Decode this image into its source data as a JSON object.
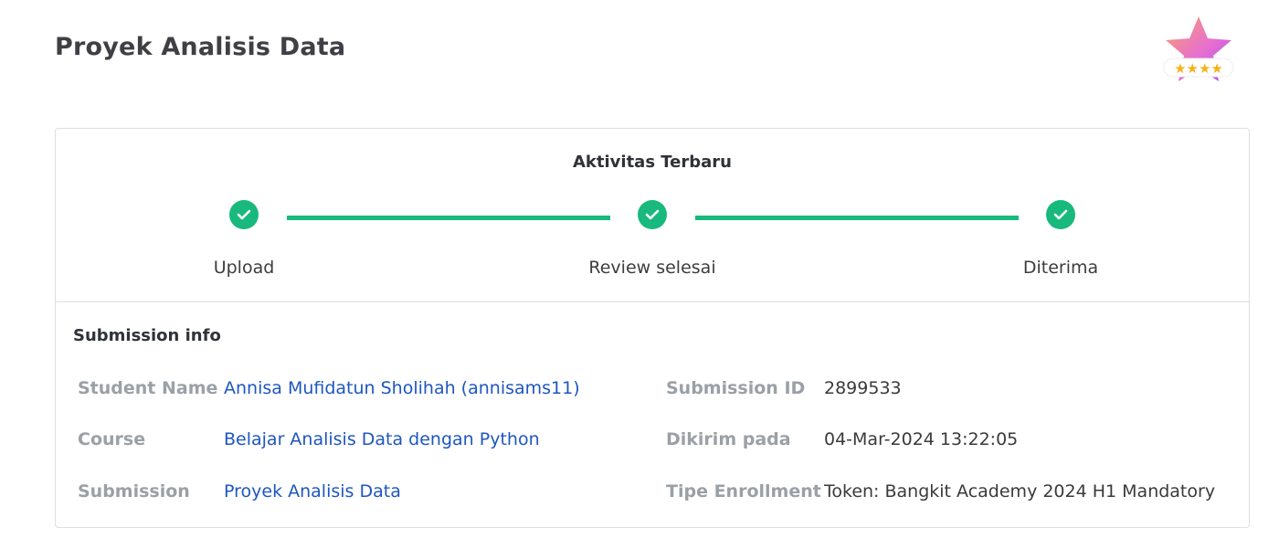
{
  "header": {
    "title": "Proyek Analisis Data",
    "badge": {
      "icon": "star-rating-badge-icon",
      "stars": 4
    }
  },
  "activity": {
    "title": "Aktivitas Terbaru",
    "steps": [
      {
        "label": "Upload",
        "status": "done"
      },
      {
        "label": "Review selesai",
        "status": "done"
      },
      {
        "label": "Diterima",
        "status": "done"
      }
    ],
    "accent_color": "#19b97d"
  },
  "submission_info": {
    "title": "Submission info",
    "student_name_label": "Student Name",
    "student_name": "Annisa Mufidatun Sholihah (annisams11)",
    "course_label": "Course",
    "course": "Belajar Analisis Data dengan Python",
    "submission_label": "Submission",
    "submission": "Proyek Analisis Data",
    "submission_id_label": "Submission ID",
    "submission_id": "2899533",
    "sent_label": "Dikirim pada",
    "sent": "04-Mar-2024 13:22:05",
    "enrollment_label": "Tipe Enrollment",
    "enrollment": "Token: Bangkit Academy 2024 H1 Mandatory",
    "link_color": "#1e56c0"
  }
}
